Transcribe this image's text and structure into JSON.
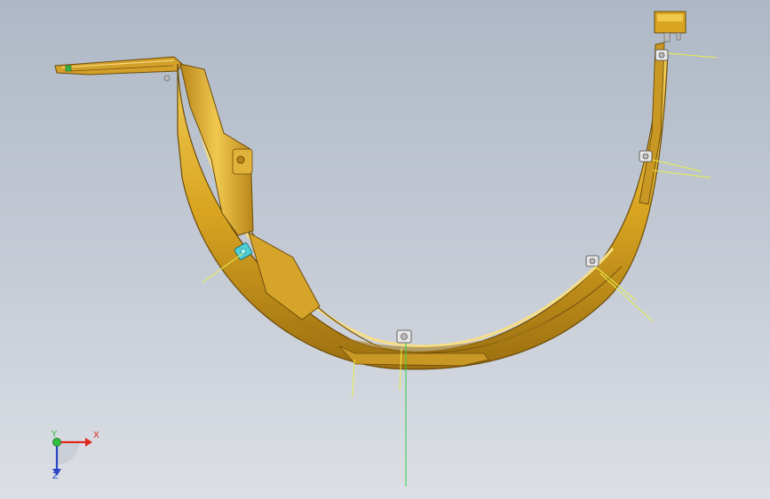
{
  "viewport": {
    "background_top": "#aeb8c6",
    "background_bottom": "#dcdfe5"
  },
  "part": {
    "body_color": "#d9a521",
    "edge_color": "#6b4c0a",
    "highlight_color": "#f3cf5a",
    "shadow_color": "#9c6f10",
    "connector_color": "#c79b2a",
    "clip_color": "#e6e6e6",
    "selected_clip_color": "#4fd0d8",
    "leader_line_color": "#e8f04a",
    "center_line_color": "#2fd24a"
  },
  "triad": {
    "x_label": "X",
    "y_label": "Y",
    "z_label": "Z",
    "x_color": "#e0281e",
    "y_color": "#2fbf3a",
    "z_color": "#2a45c8"
  }
}
